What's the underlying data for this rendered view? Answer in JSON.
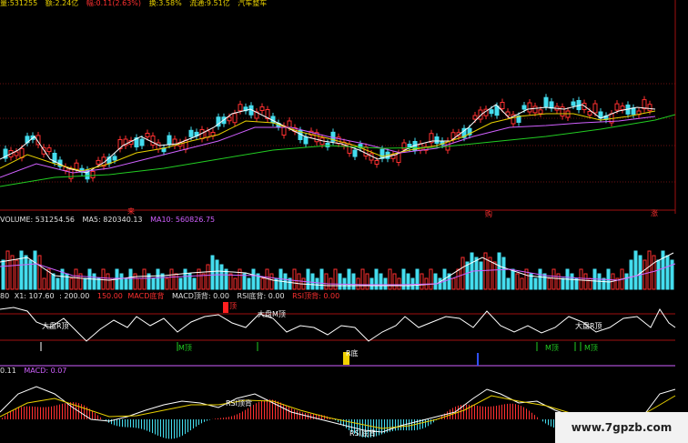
{
  "top_info": [
    {
      "text": "量:531255",
      "color": "#e8d000"
    },
    {
      "text": "额:2.24亿",
      "color": "#e8d000"
    },
    {
      "text": "幅:0.11(2.63%)",
      "color": "#ff3030"
    },
    {
      "text": "换:3.58%",
      "color": "#e8d000"
    },
    {
      "text": "流通:9.51亿",
      "color": "#e8d000"
    },
    {
      "text": "汽车整车",
      "color": "#e8d000"
    }
  ],
  "panel_markers": {
    "left": "来",
    "mid": "购",
    "right": "涨"
  },
  "volume_header": [
    {
      "text": "VOLUME: 531254.56",
      "color": "#e0e0e0"
    },
    {
      "text": "MA5: 820340.13",
      "color": "#e0e0e0"
    },
    {
      "text": "MA10: 560826.75",
      "color": "#d060ff"
    }
  ],
  "indicator_header": [
    {
      "text": "80",
      "color": "#e0e0e0"
    },
    {
      "text": "X1: 107.60",
      "color": "#e0e0e0"
    },
    {
      "text": ": 200.00",
      "color": "#e0e0e0"
    },
    {
      "text": "150.00",
      "color": "#ff3030"
    },
    {
      "text": "MACD底背",
      "color": "#ff3030"
    },
    {
      "text": "MACD顶背: 0.00",
      "color": "#e0e0e0"
    },
    {
      "text": "RSI底背: 0.00",
      "color": "#e0e0e0"
    },
    {
      "text": "RSI顶背: 0.00",
      "color": "#ff3030"
    }
  ],
  "indicator_labels": {
    "top_sell": "顶",
    "market_m_top": "大盘M顶",
    "market_r_top_left": "大盘R顶",
    "market_r_top_right": "大盘R顶",
    "m_top_1": "M顶",
    "m_top_2": "M顶",
    "m_top_3": "M顶",
    "r_bottom": "R底"
  },
  "macd_header": [
    {
      "text": "0.11",
      "color": "#e0e0e0"
    },
    {
      "text": "MACD: 0.07",
      "color": "#d060ff"
    }
  ],
  "macd_labels": {
    "rsi_top": "RSI顶背",
    "rsi_bottom": "RSI底背"
  },
  "watermark": "www.7gpzb.com",
  "colors": {
    "up": "#ff3030",
    "down": "#44ddee",
    "ma_white": "#ffffff",
    "ma_yellow": "#e8d000",
    "ma_purple": "#d060ff",
    "ma_green": "#22cc22"
  }
}
